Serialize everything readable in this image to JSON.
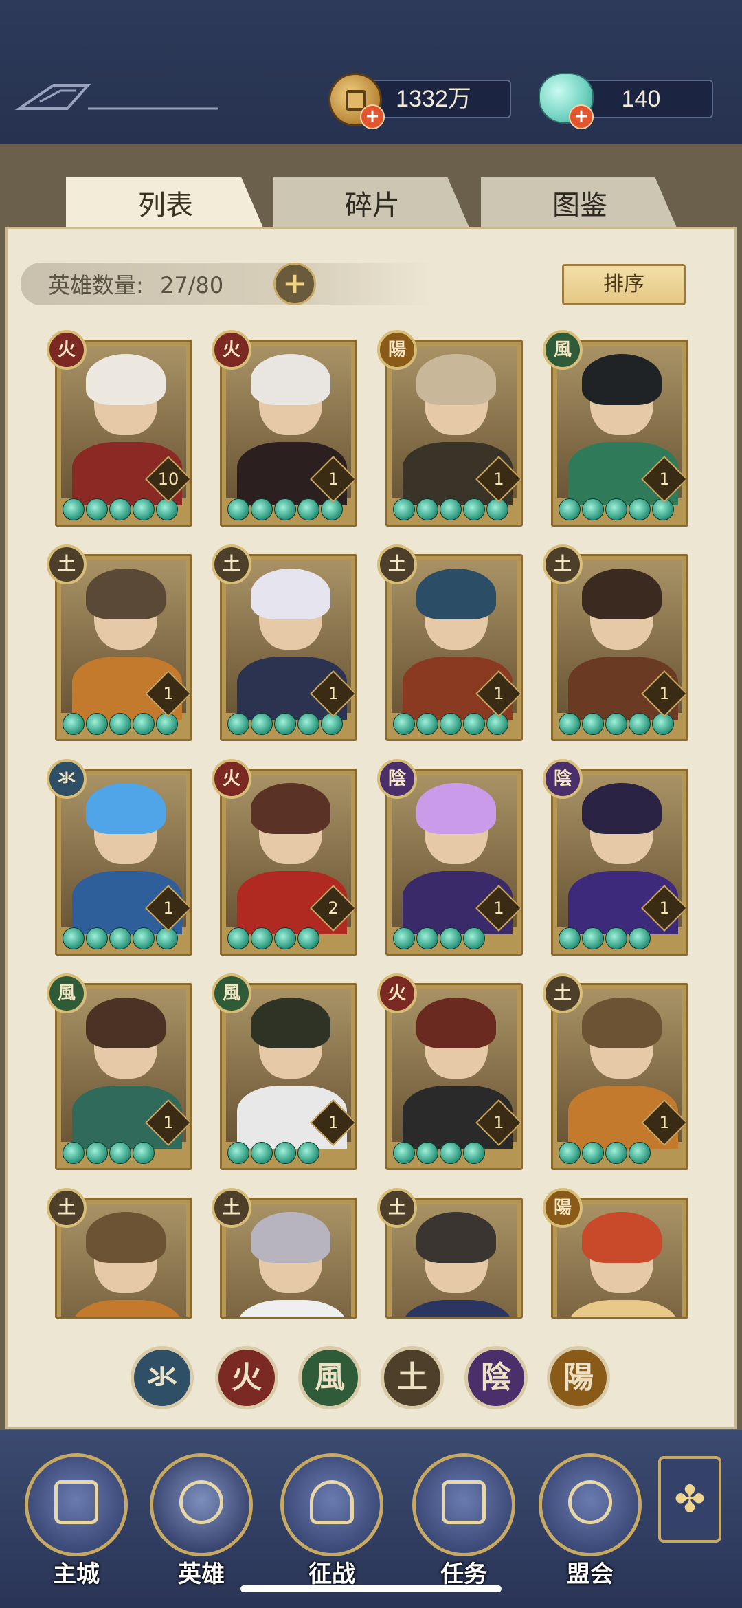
{
  "header": {
    "coins": {
      "value": "1332万",
      "icon": "copper-coin-icon"
    },
    "jade": {
      "value": "140",
      "icon": "jade-pouch-icon"
    }
  },
  "tabs": [
    {
      "label": "列表",
      "active": true
    },
    {
      "label": "碎片",
      "active": false
    },
    {
      "label": "图鉴",
      "active": false
    }
  ],
  "roster": {
    "count_label": "英雄数量:",
    "count_value": "27/80",
    "sort_label": "排序"
  },
  "elements": {
    "water": {
      "glyph": "氺",
      "color": "#2f4f66"
    },
    "fire": {
      "glyph": "火",
      "color": "#7a2a22"
    },
    "wind": {
      "glyph": "風",
      "color": "#2f5b38"
    },
    "earth": {
      "glyph": "土",
      "color": "#4d3f2a"
    },
    "yin": {
      "glyph": "陰",
      "color": "#4b2f6b"
    },
    "yang": {
      "glyph": "陽",
      "color": "#8a5a18"
    }
  },
  "heroes": [
    {
      "element": "火",
      "elem_color": "#7a2a22",
      "level": "10",
      "stars": 5,
      "hair": "#ece7df",
      "body": "#8b2a24"
    },
    {
      "element": "火",
      "elem_color": "#7a2a22",
      "level": "1",
      "stars": 5,
      "hair": "#e9e6e2",
      "body": "#2b1f1f"
    },
    {
      "element": "陽",
      "elem_color": "#8a5a18",
      "level": "1",
      "stars": 5,
      "hair": "#c9b79a",
      "body": "#3a3428"
    },
    {
      "element": "風",
      "elem_color": "#2f5b38",
      "level": "1",
      "stars": 5,
      "hair": "#1f2326",
      "body": "#2f7a58"
    },
    {
      "element": "土",
      "elem_color": "#4d3f2a",
      "level": "1",
      "stars": 5,
      "hair": "#5a4936",
      "body": "#c47a2c"
    },
    {
      "element": "土",
      "elem_color": "#4d3f2a",
      "level": "1",
      "stars": 5,
      "hair": "#e6e4ee",
      "body": "#2c3350"
    },
    {
      "element": "土",
      "elem_color": "#4d3f2a",
      "level": "1",
      "stars": 5,
      "hair": "#2b4d66",
      "body": "#8b3a22"
    },
    {
      "element": "土",
      "elem_color": "#4d3f2a",
      "level": "1",
      "stars": 5,
      "hair": "#3a2a1f",
      "body": "#6b3a22"
    },
    {
      "element": "氺",
      "elem_color": "#2f4f66",
      "level": "1",
      "stars": 5,
      "hair": "#4fa5e8",
      "body": "#2f5f9a"
    },
    {
      "element": "火",
      "elem_color": "#7a2a22",
      "level": "2",
      "stars": 4,
      "hair": "#5a3326",
      "body": "#b02a22"
    },
    {
      "element": "陰",
      "elem_color": "#4b2f6b",
      "level": "1",
      "stars": 4,
      "hair": "#c99be8",
      "body": "#3a2a6a"
    },
    {
      "element": "陰",
      "elem_color": "#4b2f6b",
      "level": "1",
      "stars": 4,
      "hair": "#2a2344",
      "body": "#3d2a7a"
    },
    {
      "element": "風",
      "elem_color": "#2f5b38",
      "level": "1",
      "stars": 4,
      "hair": "#4a3324",
      "body": "#2f6a5a"
    },
    {
      "element": "風",
      "elem_color": "#2f5b38",
      "level": "1",
      "stars": 4,
      "hair": "#2f3326",
      "body": "#e8e8e8"
    },
    {
      "element": "火",
      "elem_color": "#7a2a22",
      "level": "1",
      "stars": 4,
      "hair": "#6b2a1f",
      "body": "#2a2a2a"
    },
    {
      "element": "土",
      "elem_color": "#4d3f2a",
      "level": "1",
      "stars": 4,
      "hair": "#6b5334",
      "body": "#c47a2c"
    },
    {
      "element": "土",
      "elem_color": "#4d3f2a",
      "level": "",
      "stars": 0,
      "hair": "#6b5334",
      "body": "#c47a2c"
    },
    {
      "element": "土",
      "elem_color": "#4d3f2a",
      "level": "",
      "stars": 0,
      "hair": "#b8b4bf",
      "body": "#efefef"
    },
    {
      "element": "土",
      "elem_color": "#4d3f2a",
      "level": "",
      "stars": 0,
      "hair": "#3a3530",
      "body": "#2a3560"
    },
    {
      "element": "陽",
      "elem_color": "#8a5a18",
      "level": "",
      "stars": 0,
      "hair": "#c84a2a",
      "body": "#e8c98a"
    }
  ],
  "filters": [
    {
      "glyph": "氺",
      "color": "#2f4f66"
    },
    {
      "glyph": "火",
      "color": "#7a2a22"
    },
    {
      "glyph": "風",
      "color": "#2f5b38"
    },
    {
      "glyph": "土",
      "color": "#4d3f2a"
    },
    {
      "glyph": "陰",
      "color": "#4b2f6b"
    },
    {
      "glyph": "陽",
      "color": "#8a5a18"
    }
  ],
  "nav": [
    {
      "label": "主城",
      "icon": "city-gate-icon",
      "active": false
    },
    {
      "label": "英雄",
      "icon": "hero-portrait-icon",
      "active": true
    },
    {
      "label": "征战",
      "icon": "war-drum-icon",
      "active": false
    },
    {
      "label": "任务",
      "icon": "scroll-bell-icon",
      "active": false
    },
    {
      "label": "盟会",
      "icon": "alliance-hall-icon",
      "active": false
    }
  ],
  "more_icon": "quatrefoil-menu-icon"
}
